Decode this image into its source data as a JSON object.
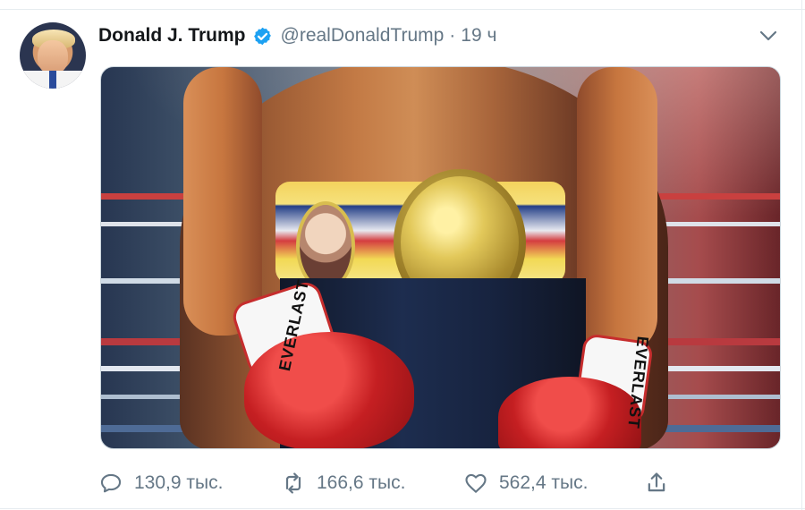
{
  "tweet": {
    "author_name": "Donald J. Trump",
    "handle": "@realDonaldTrump",
    "separator": "·",
    "time": "19 ч",
    "image_text": {
      "glove_left": "EVERLAST",
      "glove_right": "EVERLAST"
    },
    "stats": {
      "replies": "130,9 тыс.",
      "retweets": "166,6 тыс.",
      "likes": "562,4 тыс."
    }
  },
  "icons": {
    "verified": "verified-badge-icon",
    "menu": "chevron-down-icon",
    "reply": "comment-icon",
    "retweet": "retweet-icon",
    "like": "heart-icon",
    "share": "share-icon"
  },
  "colors": {
    "text": "#14171a",
    "secondary": "#657786",
    "verified": "#1da1f2",
    "border": "#e6ecf0"
  }
}
